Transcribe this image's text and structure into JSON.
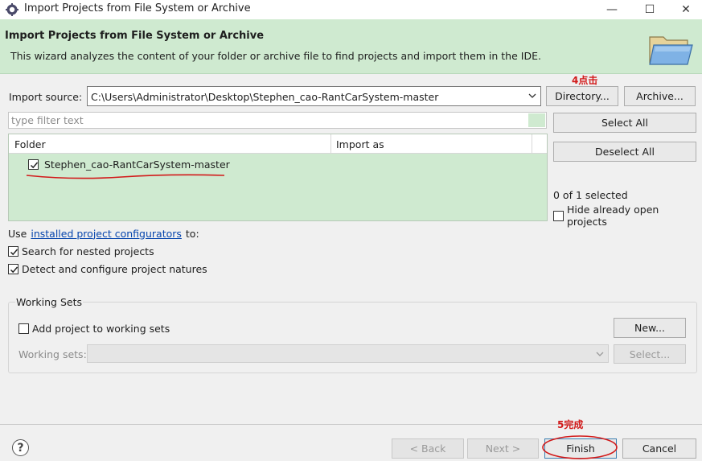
{
  "window": {
    "title": "Import Projects from File System or Archive",
    "minimize_glyph": "—",
    "maximize_glyph": "☐",
    "close_glyph": "✕"
  },
  "banner": {
    "heading": "Import Projects from File System or Archive",
    "description": "This wizard analyzes the content of your folder or archive file to find projects and import them in the IDE.",
    "icon": "folder-icon"
  },
  "import_source": {
    "label": "Import source:",
    "value": "C:\\Users\\Administrator\\Desktop\\Stephen_cao-RantCarSystem-master",
    "directory_button": "Directory...",
    "archive_button": "Archive..."
  },
  "filter": {
    "placeholder": "type filter text"
  },
  "table": {
    "columns": [
      "Folder",
      "Import as"
    ],
    "rows": [
      {
        "folder": "Stephen_cao-RantCarSystem-master",
        "import_as": "",
        "checked": true
      }
    ]
  },
  "side": {
    "select_all": "Select All",
    "deselect_all": "Deselect All",
    "selection_status": "0 of 1 selected",
    "hide_open_projects": "Hide already open projects"
  },
  "options": {
    "use_prefix": "Use",
    "configurators_link": "installed project configurators",
    "use_suffix": "to:",
    "search_nested": "Search for nested projects",
    "detect_natures": "Detect and configure project natures"
  },
  "working_sets": {
    "group_label": "Working Sets",
    "add_label": "Add project to working sets",
    "new_button": "New...",
    "sets_label": "Working sets:",
    "select_button": "Select..."
  },
  "footer": {
    "help": "?",
    "back": "< Back",
    "next": "Next >",
    "finish": "Finish",
    "cancel": "Cancel"
  },
  "annotations": {
    "step4": "4点击",
    "step5": "5完成"
  },
  "colors": {
    "accent_green": "#cfead0",
    "annotation_red": "#d21a1a",
    "link_blue": "#0645ad",
    "finish_border": "#3c7fb1"
  }
}
